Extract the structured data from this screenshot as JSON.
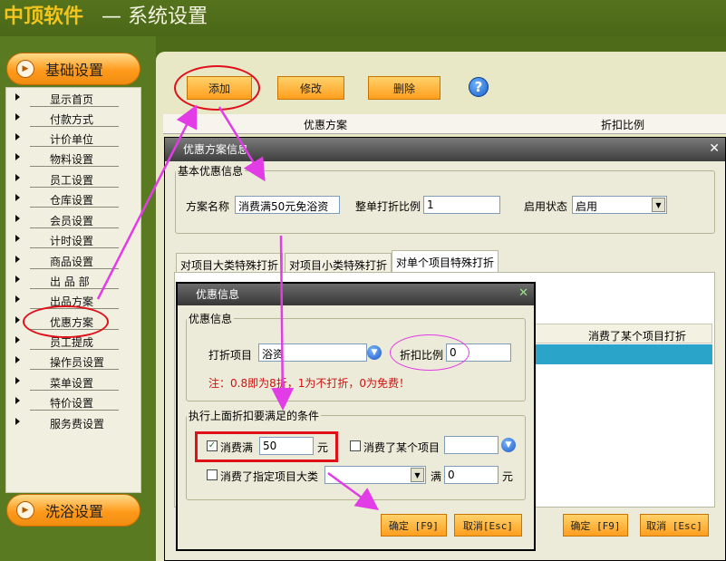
{
  "header": {
    "app_name": "中顶软件",
    "page_title": "— 系统设置"
  },
  "sidebar": {
    "section1": "基础设置",
    "items": [
      "显示首页",
      "付款方式",
      "计价单位",
      "物料设置",
      "员工设置",
      "仓库设置",
      "会员设置",
      "计时设置",
      "商品设置",
      "出 品 部",
      "出品方案",
      "优惠方案",
      "员工提成",
      "操作员设置",
      "菜单设置",
      "特价设置",
      "服务费设置"
    ],
    "section2": "洗浴设置"
  },
  "toolbar": {
    "add": "添加",
    "edit": "修改",
    "delete": "删除",
    "help": "?"
  },
  "grid": {
    "col1": "优惠方案",
    "col2": "折扣比例"
  },
  "dialog1": {
    "title": "优惠方案信息",
    "group": "基本优惠信息",
    "name_label": "方案名称",
    "name_value": "消费满50元免浴资",
    "ratio_label": "整单打折比例",
    "ratio_value": "1",
    "status_label": "启用状态",
    "status_value": "启用",
    "tabs": [
      "对项目大类特殊打折",
      "对项目小类特殊打折",
      "对单个项目特殊打折"
    ],
    "col_header": "消费了某个项目打折",
    "ok": "确定 [F9]",
    "cancel": "取消 [Esc]"
  },
  "dialog2": {
    "title": "优惠信息",
    "group1": "优惠信息",
    "item_label": "打折项目",
    "item_value": "浴资",
    "ratio_label": "折扣比例",
    "ratio_value": "0",
    "note": "注：0.8即为8折，1为不打折，0为免费！",
    "group2": "执行上面折扣要满足的条件",
    "spend_label": "消费满",
    "spend_value": "50",
    "unit": "元",
    "consumed_item_label": "消费了某个项目",
    "category_label": "消费了指定项目大类",
    "full_label": "满",
    "full_value": "0",
    "unit2": "元",
    "ok": "确定 [F9]",
    "cancel": "取消[Esc]"
  },
  "colors": {
    "accent": "#ff9e1e",
    "annotation_red": "#e0101a",
    "annotation_magenta": "#e23ce6"
  }
}
